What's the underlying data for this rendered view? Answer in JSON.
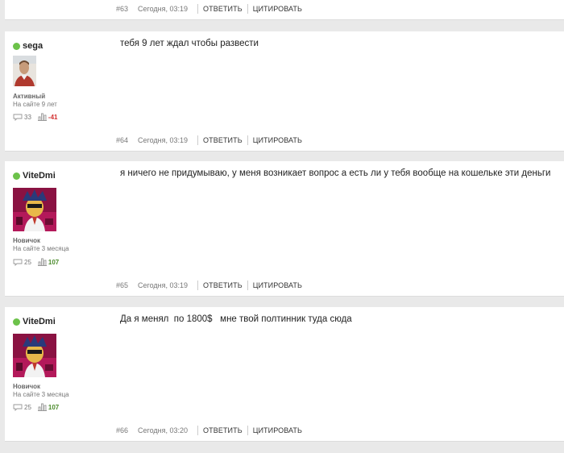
{
  "posts": [
    {
      "number": "#63",
      "time": "Сегодня, 03:19",
      "reply_label": "ОТВЕТИТЬ",
      "quote_label": "ЦИТИРОВАТЬ"
    },
    {
      "username": "sega",
      "online": true,
      "status": "Активный",
      "since": "На сайте 9 лет",
      "comments": "33",
      "rating": "-41",
      "message": "тебя 9 лет ждал чтобы развести",
      "number": "#64",
      "time": "Сегодня, 03:19",
      "reply_label": "ОТВЕТИТЬ",
      "quote_label": "ЦИТИРОВАТЬ"
    },
    {
      "username": "ViteDmi",
      "online": true,
      "status": "Новичок",
      "since": "На сайте 3 месяца",
      "comments": "25",
      "rating": "107",
      "message": "я ничего не придумываю, у меня возникает вопрос а есть ли у тебя вообще на кошельке эти деньги",
      "number": "#65",
      "time": "Сегодня, 03:19",
      "reply_label": "ОТВЕТИТЬ",
      "quote_label": "ЦИТИРОВАТЬ"
    },
    {
      "username": "ViteDmi",
      "online": true,
      "status": "Новичок",
      "since": "На сайте 3 месяца",
      "comments": "25",
      "rating": "107",
      "message": "Да я менял  по 1800$   мне твой полтинник туда сюда",
      "number": "#66",
      "time": "Сегодня, 03:20",
      "reply_label": "ОТВЕТИТЬ",
      "quote_label": "ЦИТИРОВАТЬ"
    }
  ],
  "icons": {
    "online": "online-indicator-icon",
    "comments": "comment-bubble-icon",
    "rating": "rating-bars-icon"
  },
  "colors": {
    "online": "#6cc24a",
    "rating_negative": "#d32f2f",
    "rating_positive": "#4a8a2a",
    "background": "#e9e9e9",
    "card": "#ffffff"
  }
}
